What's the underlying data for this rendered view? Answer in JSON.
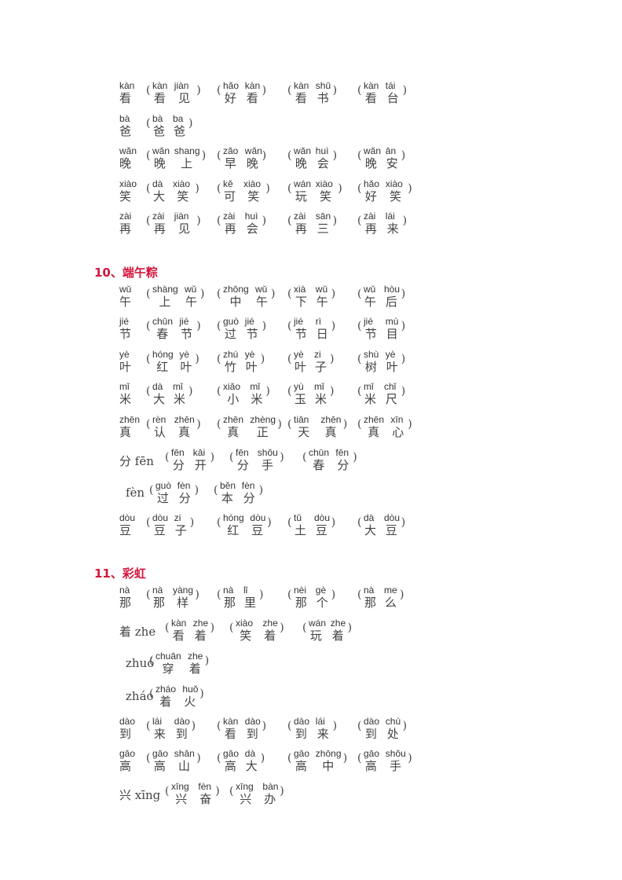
{
  "sections": [
    {
      "heading": null,
      "rows": [
        {
          "head": {
            "py": "kàn",
            "hz": "看"
          },
          "words": [
            {
              "py": [
                "kàn",
                "jiàn"
              ],
              "hz": [
                "看",
                "见"
              ]
            },
            {
              "py": [
                "hǎo",
                "kàn"
              ],
              "hz": [
                "好",
                "看"
              ]
            },
            {
              "py": [
                "kàn",
                "shū"
              ],
              "hz": [
                "看",
                "书"
              ]
            },
            {
              "py": [
                "kàn",
                "tái"
              ],
              "hz": [
                "看",
                "台"
              ]
            }
          ]
        },
        {
          "head": {
            "py": "bà",
            "hz": "爸"
          },
          "words": [
            {
              "py": [
                "bà",
                "ba"
              ],
              "hz": [
                "爸",
                "爸"
              ]
            }
          ]
        },
        {
          "head": {
            "py": "wǎn",
            "hz": "晚"
          },
          "words": [
            {
              "py": [
                "wǎn",
                "shang"
              ],
              "hz": [
                "晚",
                "上"
              ]
            },
            {
              "py": [
                "zǎo",
                "wǎn"
              ],
              "hz": [
                "早",
                "晚"
              ]
            },
            {
              "py": [
                "wǎn",
                "huì"
              ],
              "hz": [
                "晚",
                "会"
              ]
            },
            {
              "py": [
                "wǎn",
                "ān"
              ],
              "hz": [
                "晚",
                "安"
              ]
            }
          ]
        },
        {
          "head": {
            "py": "xiào",
            "hz": "笑"
          },
          "words": [
            {
              "py": [
                "dà",
                "xiào"
              ],
              "hz": [
                "大",
                "笑"
              ]
            },
            {
              "py": [
                "kě",
                "xiào"
              ],
              "hz": [
                "可",
                "笑"
              ]
            },
            {
              "py": [
                "wán",
                "xiào"
              ],
              "hz": [
                "玩",
                "笑"
              ]
            },
            {
              "py": [
                "hǎo",
                "xiào"
              ],
              "hz": [
                "好",
                "笑"
              ]
            }
          ]
        },
        {
          "head": {
            "py": "zài",
            "hz": "再"
          },
          "words": [
            {
              "py": [
                "zài",
                "jiàn"
              ],
              "hz": [
                "再",
                "见"
              ]
            },
            {
              "py": [
                "zài",
                "huì"
              ],
              "hz": [
                "再",
                "会"
              ]
            },
            {
              "py": [
                "zài",
                "sān"
              ],
              "hz": [
                "再",
                "三"
              ]
            },
            {
              "py": [
                "zài",
                "lái"
              ],
              "hz": [
                "再",
                "来"
              ]
            }
          ]
        }
      ]
    },
    {
      "heading": "10、端午粽",
      "rows": [
        {
          "head": {
            "py": "wǔ",
            "hz": "午"
          },
          "words": [
            {
              "py": [
                "shàng",
                "wǔ"
              ],
              "hz": [
                "上",
                "午"
              ]
            },
            {
              "py": [
                "zhōng",
                "wǔ"
              ],
              "hz": [
                "中",
                "午"
              ]
            },
            {
              "py": [
                "xià",
                "wǔ"
              ],
              "hz": [
                "下",
                "午"
              ]
            },
            {
              "py": [
                "wǔ",
                "hòu"
              ],
              "hz": [
                "午",
                "后"
              ]
            }
          ]
        },
        {
          "head": {
            "py": "jié",
            "hz": "节"
          },
          "words": [
            {
              "py": [
                "chūn",
                "jié"
              ],
              "hz": [
                "春",
                "节"
              ]
            },
            {
              "py": [
                "guò",
                "jié"
              ],
              "hz": [
                "过",
                "节"
              ]
            },
            {
              "py": [
                "jié",
                "rì"
              ],
              "hz": [
                "节",
                "日"
              ]
            },
            {
              "py": [
                "jié",
                "mù"
              ],
              "hz": [
                "节",
                "目"
              ]
            }
          ]
        },
        {
          "head": {
            "py": "yè",
            "hz": "叶"
          },
          "words": [
            {
              "py": [
                "hóng",
                "yè"
              ],
              "hz": [
                "红",
                "叶"
              ]
            },
            {
              "py": [
                "zhú",
                "yè"
              ],
              "hz": [
                "竹",
                "叶"
              ]
            },
            {
              "py": [
                "yè",
                "zi"
              ],
              "hz": [
                "叶",
                "子"
              ]
            },
            {
              "py": [
                "shù",
                "yè"
              ],
              "hz": [
                "树",
                "叶"
              ]
            }
          ]
        },
        {
          "head": {
            "py": "mǐ",
            "hz": "米"
          },
          "words": [
            {
              "py": [
                "dà",
                "mǐ"
              ],
              "hz": [
                "大",
                "米"
              ]
            },
            {
              "py": [
                "xiǎo",
                "mǐ"
              ],
              "hz": [
                "小",
                "米"
              ]
            },
            {
              "py": [
                "yù",
                "mǐ"
              ],
              "hz": [
                "玉",
                "米"
              ]
            },
            {
              "py": [
                "mǐ",
                "chǐ"
              ],
              "hz": [
                "米",
                "尺"
              ]
            }
          ]
        },
        {
          "head": {
            "py": "zhēn",
            "hz": "真"
          },
          "words": [
            {
              "py": [
                "rèn",
                "zhēn"
              ],
              "hz": [
                "认",
                "真"
              ]
            },
            {
              "py": [
                "zhēn",
                "zhèng"
              ],
              "hz": [
                "真",
                "正"
              ]
            },
            {
              "py": [
                "tiān",
                "zhēn"
              ],
              "hz": [
                "天",
                "真"
              ]
            },
            {
              "py": [
                "zhēn",
                "xīn"
              ],
              "hz": [
                "真",
                "心"
              ]
            }
          ]
        },
        {
          "label": "分 fēn",
          "words": [
            {
              "py": [
                "fēn",
                "kāi"
              ],
              "hz": [
                "分",
                "开"
              ]
            },
            {
              "py": [
                "fēn",
                "shǒu"
              ],
              "hz": [
                "分",
                "手"
              ]
            },
            {
              "py": [
                "chūn",
                "fēn"
              ],
              "hz": [
                "春",
                "分"
              ]
            }
          ]
        },
        {
          "label": "fèn",
          "indent": true,
          "words": [
            {
              "py": [
                "guò",
                "fèn"
              ],
              "hz": [
                "过",
                "分"
              ]
            },
            {
              "py": [
                "běn",
                "fèn"
              ],
              "hz": [
                "本",
                "分"
              ]
            }
          ]
        },
        {
          "head": {
            "py": "dòu",
            "hz": "豆"
          },
          "words": [
            {
              "py": [
                "dòu",
                "zi"
              ],
              "hz": [
                "豆",
                "子"
              ]
            },
            {
              "py": [
                "hóng",
                "dòu"
              ],
              "hz": [
                "红",
                "豆"
              ]
            },
            {
              "py": [
                "tǔ",
                "dòu"
              ],
              "hz": [
                "土",
                "豆"
              ]
            },
            {
              "py": [
                "dà",
                "dòu"
              ],
              "hz": [
                "大",
                "豆"
              ]
            }
          ]
        }
      ]
    },
    {
      "heading": "11、彩虹",
      "rows": [
        {
          "head": {
            "py": "nà",
            "hz": "那"
          },
          "words": [
            {
              "py": [
                "nà",
                "yàng"
              ],
              "hz": [
                "那",
                "样"
              ]
            },
            {
              "py": [
                "nà",
                "lǐ"
              ],
              "hz": [
                "那",
                "里"
              ]
            },
            {
              "py": [
                "nèi",
                "gè"
              ],
              "hz": [
                "那",
                "个"
              ]
            },
            {
              "py": [
                "nà",
                "me"
              ],
              "hz": [
                "那",
                "么"
              ]
            }
          ]
        },
        {
          "label": "着 zhe",
          "words": [
            {
              "py": [
                "kàn",
                "zhe"
              ],
              "hz": [
                "看",
                "着"
              ]
            },
            {
              "py": [
                "xiào",
                "zhe"
              ],
              "hz": [
                "笑",
                "着"
              ]
            },
            {
              "py": [
                "wán",
                "zhe"
              ],
              "hz": [
                "玩",
                "着"
              ]
            }
          ]
        },
        {
          "label": "zhuó",
          "indent": true,
          "words": [
            {
              "py": [
                "chuān",
                "zhe"
              ],
              "hz": [
                "穿",
                "着"
              ]
            }
          ]
        },
        {
          "label": "zháo",
          "indent": true,
          "words": [
            {
              "py": [
                "zháo",
                "huǒ"
              ],
              "hz": [
                "着",
                "火"
              ]
            }
          ]
        },
        {
          "head": {
            "py": "dào",
            "hz": "到"
          },
          "words": [
            {
              "py": [
                "lái",
                "dào"
              ],
              "hz": [
                "来",
                "到"
              ]
            },
            {
              "py": [
                "kàn",
                "dào"
              ],
              "hz": [
                "看",
                "到"
              ]
            },
            {
              "py": [
                "dào",
                "lái"
              ],
              "hz": [
                "到",
                "来"
              ]
            },
            {
              "py": [
                "dào",
                "chù"
              ],
              "hz": [
                "到",
                "处"
              ]
            }
          ]
        },
        {
          "head": {
            "py": "gāo",
            "hz": "高"
          },
          "words": [
            {
              "py": [
                "gāo",
                "shān"
              ],
              "hz": [
                "高",
                "山"
              ]
            },
            {
              "py": [
                "gāo",
                "dà"
              ],
              "hz": [
                "高",
                "大"
              ]
            },
            {
              "py": [
                "gāo",
                "zhōng"
              ],
              "hz": [
                "高",
                "中"
              ]
            },
            {
              "py": [
                "gāo",
                "shǒu"
              ],
              "hz": [
                "高",
                "手"
              ]
            }
          ]
        },
        {
          "label": "兴 xīng",
          "words": [
            {
              "py": [
                "xīng",
                "fèn"
              ],
              "hz": [
                "兴",
                "奋"
              ]
            },
            {
              "py": [
                "xīng",
                "bàn"
              ],
              "hz": [
                "兴",
                "办"
              ]
            }
          ]
        }
      ]
    }
  ]
}
